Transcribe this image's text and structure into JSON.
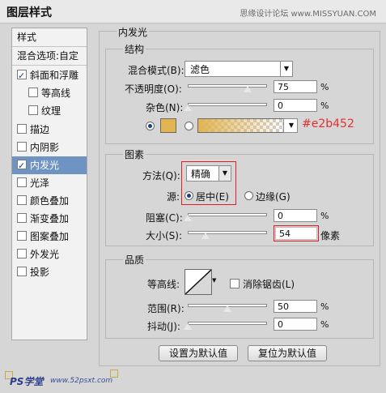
{
  "window": {
    "title": "图层样式",
    "watermark": "思缘设计论坛  www.MISSYUAN.COM"
  },
  "sidebar": {
    "items": [
      {
        "label": "样式",
        "checkbox": false,
        "checked": false,
        "selected": false
      },
      {
        "label": "混合选项:自定",
        "checkbox": false,
        "checked": false,
        "selected": false
      },
      {
        "label": "斜面和浮雕",
        "checkbox": true,
        "checked": true,
        "selected": false
      },
      {
        "label": "等高线",
        "checkbox": true,
        "checked": false,
        "selected": false,
        "indent": true
      },
      {
        "label": "纹理",
        "checkbox": true,
        "checked": false,
        "selected": false,
        "indent": true
      },
      {
        "label": "描边",
        "checkbox": true,
        "checked": false,
        "selected": false
      },
      {
        "label": "内阴影",
        "checkbox": true,
        "checked": false,
        "selected": false
      },
      {
        "label": "内发光",
        "checkbox": true,
        "checked": true,
        "selected": true
      },
      {
        "label": "光泽",
        "checkbox": true,
        "checked": false,
        "selected": false
      },
      {
        "label": "颜色叠加",
        "checkbox": true,
        "checked": false,
        "selected": false
      },
      {
        "label": "渐变叠加",
        "checkbox": true,
        "checked": false,
        "selected": false
      },
      {
        "label": "图案叠加",
        "checkbox": true,
        "checked": false,
        "selected": false
      },
      {
        "label": "外发光",
        "checkbox": true,
        "checked": false,
        "selected": false
      },
      {
        "label": "投影",
        "checkbox": true,
        "checked": false,
        "selected": false
      }
    ]
  },
  "panel": {
    "title": "内发光",
    "structure": {
      "title": "结构",
      "blend_mode_label": "混合模式(B):",
      "blend_mode_value": "滤色",
      "opacity_label": "不透明度(O):",
      "opacity_value": "75",
      "opacity_level": 0.75,
      "noise_label": "杂色(N):",
      "noise_value": "0",
      "noise_level": 0.0,
      "percent": "%",
      "color_hex_annotation": "#e2b452",
      "color_swatch": "#e2b452"
    },
    "elements": {
      "title": "图素",
      "technique_label": "方法(Q):",
      "technique_value": "精确",
      "source_label": "源:",
      "source_center": "居中(E)",
      "source_edge": "边缘(G)",
      "choke_label": "阻塞(C):",
      "choke_value": "0",
      "choke_level": 0.0,
      "size_label": "大小(S):",
      "size_value": "54",
      "size_level": 0.22,
      "size_unit": "像素",
      "percent": "%"
    },
    "quality": {
      "title": "品质",
      "contour_label": "等高线:",
      "antialias_label": "消除锯齿(L)",
      "range_label": "范围(R):",
      "range_value": "50",
      "range_level": 0.5,
      "jitter_label": "抖动(J):",
      "jitter_value": "0",
      "jitter_level": 0.0,
      "percent": "%"
    },
    "buttons": {
      "default": "设置为默认值",
      "reset": "复位为默认值"
    }
  },
  "footer": {
    "logo_text": "PS学堂",
    "url": "www.52psxt.com"
  },
  "colors": {
    "annotation_red": "#e23030",
    "selection_blue": "#6f93c2",
    "swatch": "#e2b452"
  }
}
